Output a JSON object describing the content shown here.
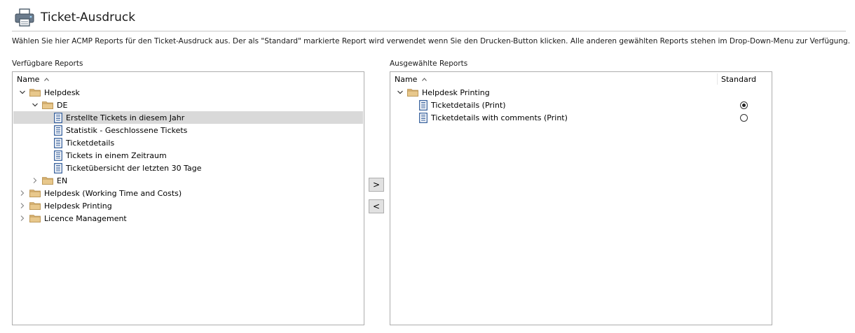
{
  "header": {
    "title": "Ticket-Ausdruck",
    "icon": "printer-icon"
  },
  "description": "Wählen Sie hier ACMP Reports für den Ticket-Ausdruck aus. Der als \"Standard\" markierte Report wird verwendet wenn Sie den Drucken-Button klicken. Alle anderen gewählten Reports stehen im Drop-Down-Menu zur Verfügung.",
  "left_panel": {
    "label": "Verfügbare Reports",
    "column_name": "Name",
    "tree": [
      {
        "label": "Helpdesk",
        "type": "folder",
        "expanded": true
      },
      {
        "label": "DE",
        "type": "folder",
        "expanded": true
      },
      {
        "label": "Erstellte Tickets in diesem Jahr",
        "type": "report",
        "selected": true
      },
      {
        "label": "Statistik - Geschlossene Tickets",
        "type": "report"
      },
      {
        "label": "Ticketdetails",
        "type": "report"
      },
      {
        "label": "Tickets in einem Zeitraum",
        "type": "report"
      },
      {
        "label": "Ticketübersicht der letzten 30 Tage",
        "type": "report"
      },
      {
        "label": "EN",
        "type": "folder",
        "expanded": false
      },
      {
        "label": "Helpdesk (Working Time and Costs)",
        "type": "folder",
        "expanded": false
      },
      {
        "label": "Helpdesk Printing",
        "type": "folder",
        "expanded": false
      },
      {
        "label": "Licence Management",
        "type": "folder",
        "expanded": false
      }
    ]
  },
  "buttons": {
    "add": ">",
    "remove": "<"
  },
  "right_panel": {
    "label": "Ausgewählte Reports",
    "column_name": "Name",
    "column_standard": "Standard",
    "tree": [
      {
        "label": "Helpdesk Printing",
        "type": "folder",
        "expanded": true
      },
      {
        "label": "Ticketdetails (Print)",
        "type": "report",
        "standard": true
      },
      {
        "label": "Ticketdetails with comments (Print)",
        "type": "report",
        "standard": false
      }
    ]
  },
  "colors": {
    "folder": "#dcb67a",
    "report_icon": "#2b5797",
    "selection": "#d9d9d9"
  }
}
